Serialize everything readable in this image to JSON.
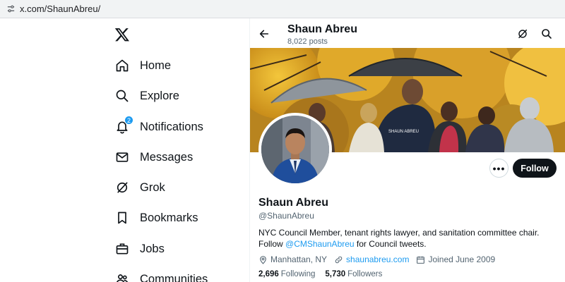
{
  "browser": {
    "url": "x.com/ShaunAbreu/"
  },
  "sidebar": {
    "notification_count": "2",
    "items": [
      {
        "label": "Home",
        "icon": "home-icon"
      },
      {
        "label": "Explore",
        "icon": "search-icon"
      },
      {
        "label": "Notifications",
        "icon": "bell-icon"
      },
      {
        "label": "Messages",
        "icon": "envelope-icon"
      },
      {
        "label": "Grok",
        "icon": "grok-icon"
      },
      {
        "label": "Bookmarks",
        "icon": "bookmark-icon"
      },
      {
        "label": "Jobs",
        "icon": "briefcase-icon"
      },
      {
        "label": "Communities",
        "icon": "people-icon"
      }
    ]
  },
  "header": {
    "name": "Shaun Abreu",
    "posts": "8,022 posts"
  },
  "profile": {
    "name": "Shaun Abreu",
    "handle": "@ShaunAbreu",
    "bio_text": "NYC Council Member, tenant rights lawyer, and sanitation committee chair. Follow ",
    "bio_link": "@CMShaunAbreu",
    "bio_tail": " for Council tweets.",
    "location": "Manhattan, NY",
    "website": "shaunabreu.com",
    "joined": "Joined June 2009",
    "following_count": "2,696",
    "following_label": "Following",
    "followers_count": "5,730",
    "followers_label": "Followers",
    "more_label": "•••",
    "follow_label": "Follow"
  },
  "colors": {
    "accent": "#1d9bf0",
    "text": "#0f1419",
    "muted": "#536471"
  }
}
